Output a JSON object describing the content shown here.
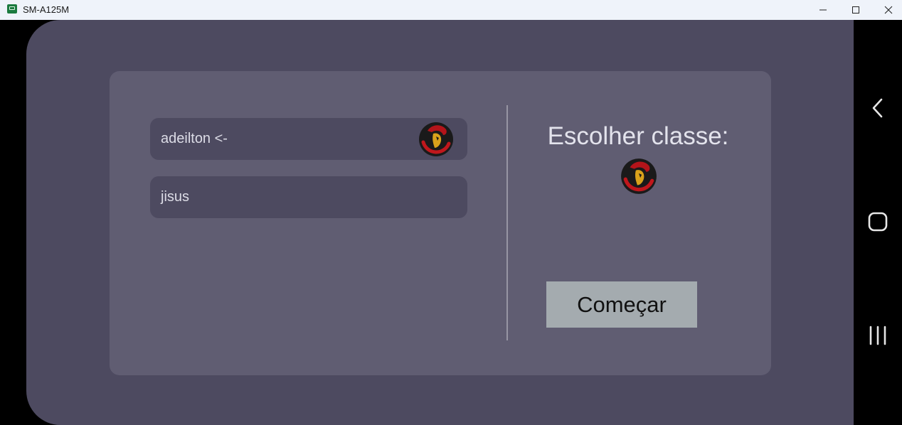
{
  "window": {
    "title": "SM-A125M"
  },
  "players": [
    {
      "name": "adeilton <-",
      "has_class_icon": true
    },
    {
      "name": "jisus",
      "has_class_icon": false
    }
  ],
  "class_panel": {
    "title": "Escolher classe:",
    "icon": "red-warrior-class-icon"
  },
  "start_button": {
    "label": "Começar"
  },
  "colors": {
    "screen_bg": "#4d4a60",
    "card_bg": "#605d72",
    "row_bg": "#4d4a60",
    "button_bg": "#a4abaf",
    "accent_red": "#c0171c"
  }
}
